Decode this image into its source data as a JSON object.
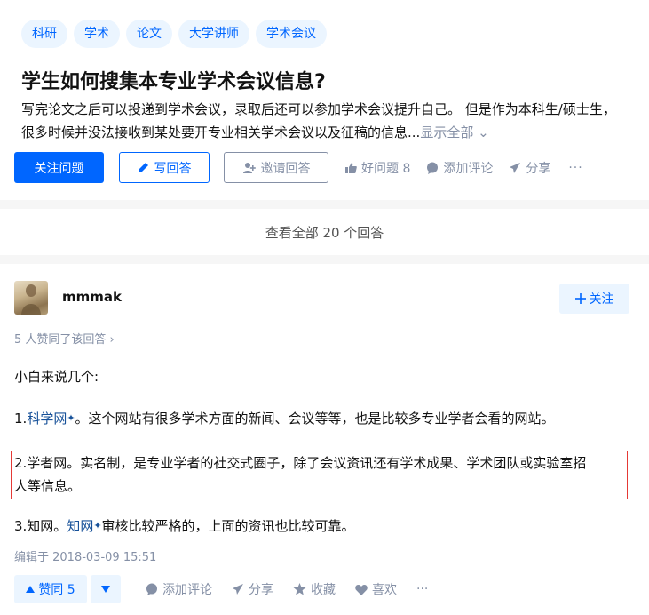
{
  "question": {
    "topics": [
      "科研",
      "学术",
      "论文",
      "大学讲师",
      "学术会议"
    ],
    "title": "学生如何搜集本专业学术会议信息?",
    "detail_line1": "写完论文之后可以投递到学术会议，录取后还可以参加学术会议提升自己。 但是作为本科生/硕士生，",
    "detail_line2": "很多时候并没法接收到某处要开专业相关学术会议以及征稿的信息...",
    "show_all": "显示全部 ⌄",
    "actions": {
      "follow": "关注问题",
      "write_answer": "写回答",
      "invite": "邀请回答",
      "good_question": "好问题 8",
      "add_comment": "添加评论",
      "share": "分享",
      "more": "···"
    }
  },
  "view_all_answers": "查看全部 20 个回答",
  "answer": {
    "author": "mmmak",
    "follow_label": "关注",
    "vote_summary": "5 人赞同了该回答 ›",
    "intro": "小白来说几个:",
    "item1_prefix": "1.",
    "item1_link": "科学网",
    "item1_rest": "。这个网站有很多学术方面的新闻、会议等等，也是比较多专业学者会看的网站。",
    "item2_line1": "2.学者网。实名制，是专业学者的社交式圈子，除了会议资讯还有学术成果、学术团队或实验室招",
    "item2_line2": "人等信息。",
    "item3_prefix": "3.知网。",
    "item3_link": "知网",
    "item3_rest": "审核比较严格的，上面的资讯也比较可靠。",
    "edited": "编辑于 2018-03-09 15:51",
    "actions": {
      "vote_up": "赞同 5",
      "add_comment": "添加评论",
      "share": "分享",
      "collect": "收藏",
      "like": "喜欢",
      "more": "···"
    }
  },
  "icons": [
    "pen-icon",
    "invite-user-icon",
    "thumb-up-icon",
    "comment-icon",
    "share-icon",
    "plus-icon",
    "triangle-up-icon",
    "triangle-down-icon",
    "star-icon",
    "heart-icon"
  ],
  "colors": {
    "brand_blue": "#0066ff",
    "light_blue_bg": "#ebf5ff",
    "link_blue": "#175199",
    "meta_gray": "#8590a6",
    "highlight_red": "#e53935"
  }
}
